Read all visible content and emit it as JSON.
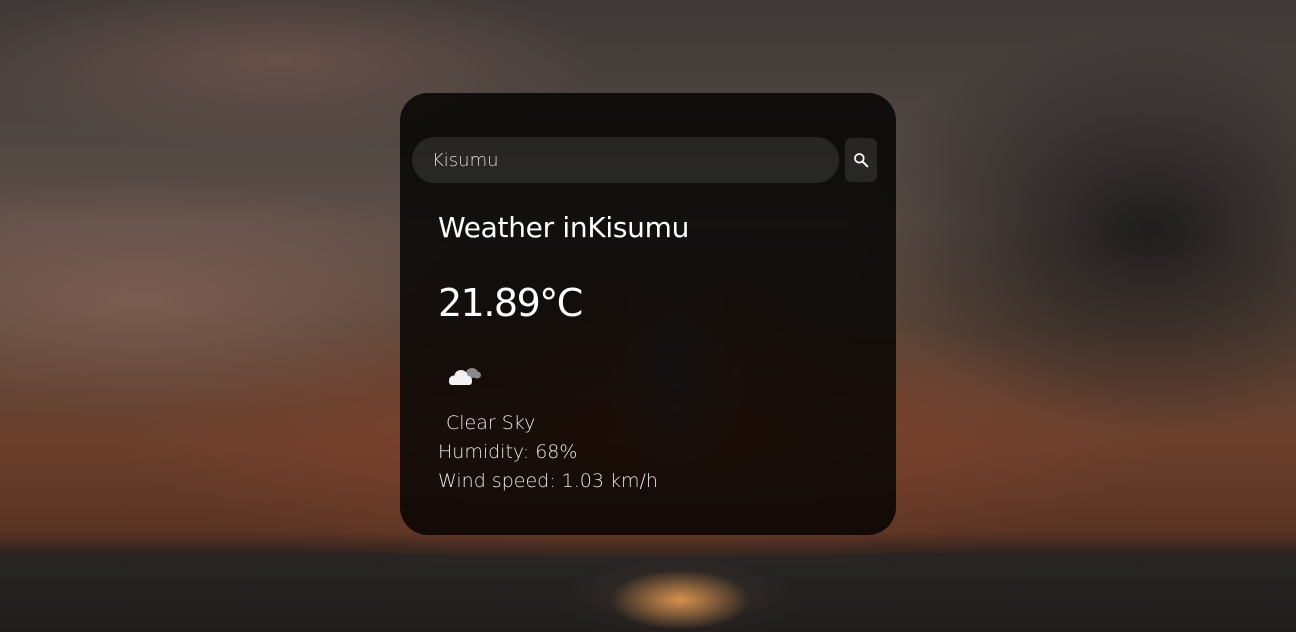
{
  "search": {
    "value": "Kisumu",
    "button_icon": "search-icon"
  },
  "weather": {
    "title_prefix": "Weather in",
    "city": "Kisumu",
    "temperature": "21.89°C",
    "icon": "cloud-icon",
    "description": "Clear Sky",
    "humidity": "Humidity: 68%",
    "wind": "Wind speed: 1.03 km/h"
  },
  "colors": {
    "card_background": "#000000cc",
    "text": "#ffffff",
    "input_background": "#ffffff1a"
  }
}
